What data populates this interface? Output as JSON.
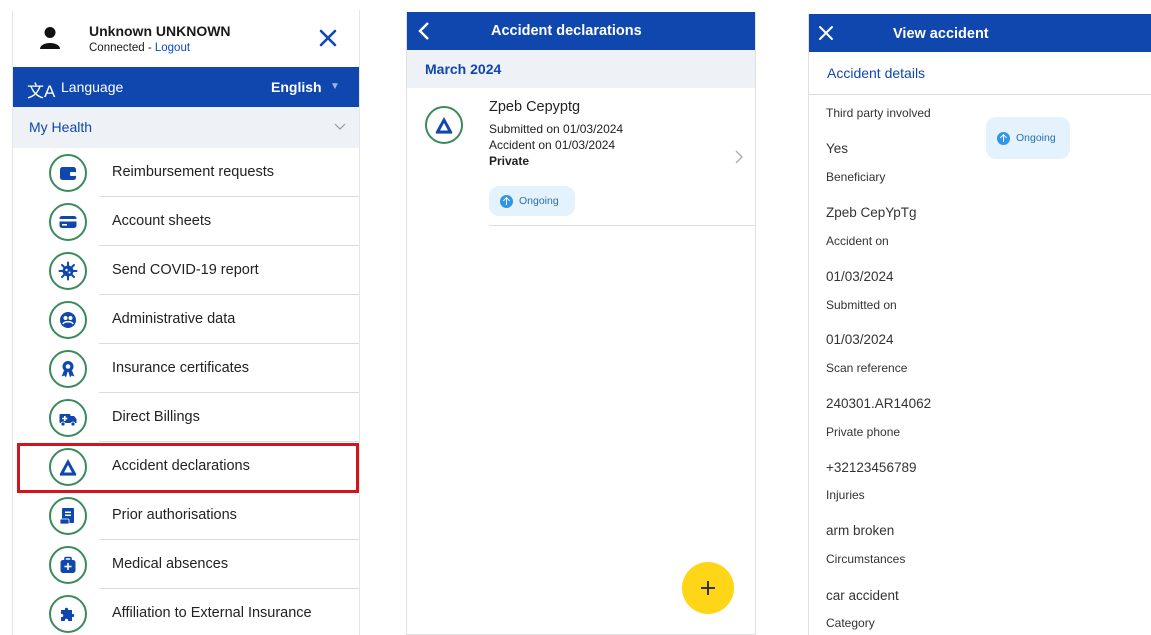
{
  "menu": {
    "user_name": "Unknown UNKNOWN",
    "connected_text": "Connected - ",
    "logout_label": "Logout",
    "language_label": "Language",
    "language_value": "English",
    "section_label": "My Health",
    "items": [
      {
        "label": "Reimbursement requests",
        "icon": "wallet-icon"
      },
      {
        "label": "Account sheets",
        "icon": "credit-card-icon"
      },
      {
        "label": "Send COVID-19 report",
        "icon": "virus-icon"
      },
      {
        "label": "Administrative data",
        "icon": "person-data-icon"
      },
      {
        "label": "Insurance certificates",
        "icon": "certificate-badge-icon"
      },
      {
        "label": "Direct Billings",
        "icon": "ambulance-icon"
      },
      {
        "label": "Accident declarations",
        "icon": "accident-triangle-icon"
      },
      {
        "label": "Prior authorisations",
        "icon": "document-stamp-icon"
      },
      {
        "label": "Medical absences",
        "icon": "medical-bag-icon"
      },
      {
        "label": "Affiliation to External Insurance",
        "icon": "puzzle-icon"
      }
    ],
    "selected_item": "Accident declarations"
  },
  "list": {
    "title": "Accident declarations",
    "month": "March 2024",
    "entry": {
      "name": "Zpeb Cepyptg",
      "submitted": "Submitted on 01/03/2024",
      "accident": "Accident on 01/03/2024",
      "type": "Private",
      "status": "Ongoing"
    },
    "add_icon": "plus-icon"
  },
  "detail": {
    "title": "View accident",
    "tab": "Accident details",
    "status": "Ongoing",
    "fields": [
      {
        "label": "Third party involved",
        "value": "Yes"
      },
      {
        "label": "Beneficiary",
        "value": "Zpeb CepYpTg"
      },
      {
        "label": "Accident on",
        "value": "01/03/2024"
      },
      {
        "label": "Submitted on",
        "value": "01/03/2024"
      },
      {
        "label": "Scan reference",
        "value": "240301.AR14062"
      },
      {
        "label": "Private phone",
        "value": "+32123456789"
      },
      {
        "label": "Injuries",
        "value": "arm broken"
      },
      {
        "label": "Circumstances",
        "value": "car accident"
      },
      {
        "label": "Category",
        "value": ""
      }
    ]
  },
  "colors": {
    "brand_blue": "#0f47af",
    "icon_green": "#3a8a5c",
    "highlight_red": "#d4141c",
    "fab_yellow": "#ffd617",
    "status_blue": "#2d96e6"
  }
}
